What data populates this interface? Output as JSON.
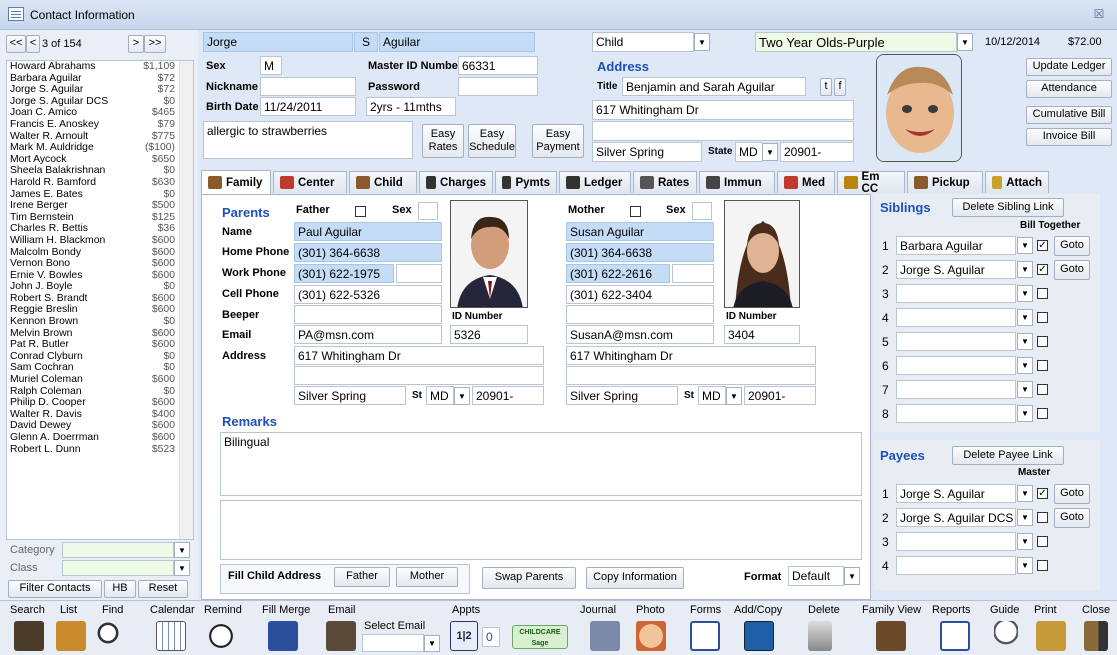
{
  "window": {
    "title": "Contact Information",
    "close": "☒"
  },
  "nav": {
    "first": "<<",
    "prev": "<",
    "record": "3 of 154",
    "next": ">",
    "last": ">>"
  },
  "contacts": [
    [
      "Howard Abrahams",
      "$1,109"
    ],
    [
      "Barbara Aguilar",
      "$72"
    ],
    [
      "Jorge S. Aguilar",
      "$72"
    ],
    [
      "Jorge S. Aguilar DCS",
      "$0"
    ],
    [
      "Joan C. Amico",
      "$465"
    ],
    [
      "Francis E. Anoskey",
      "$79"
    ],
    [
      "Walter R. Arnoult",
      "$775"
    ],
    [
      "Mark M. Auldridge",
      "($100)"
    ],
    [
      "Mort Aycock",
      "$650"
    ],
    [
      "Sheela Balakrishnan",
      "$0"
    ],
    [
      "Harold R. Bamford",
      "$630"
    ],
    [
      "James E. Bates",
      "$0"
    ],
    [
      "Irene Berger",
      "$500"
    ],
    [
      "Tim Bernstein",
      "$125"
    ],
    [
      "Charles R. Bettis",
      "$36"
    ],
    [
      "William H. Blackmon",
      "$600"
    ],
    [
      "Malcolm Bondy",
      "$600"
    ],
    [
      "Vernon Bono",
      "$600"
    ],
    [
      "Ernie V. Bowles",
      "$600"
    ],
    [
      "John J. Boyle",
      "$0"
    ],
    [
      "Robert S. Brandt",
      "$600"
    ],
    [
      "Reggie Breslin",
      "$600"
    ],
    [
      "Kennon Brown",
      "$0"
    ],
    [
      "Melvin Brown",
      "$600"
    ],
    [
      "Pat R. Butler",
      "$600"
    ],
    [
      "Conrad Clyburn",
      "$0"
    ],
    [
      "Sam Cochran",
      "$0"
    ],
    [
      "Muriel Coleman",
      "$600"
    ],
    [
      "Ralph Coleman",
      "$0"
    ],
    [
      "Philip D. Cooper",
      "$600"
    ],
    [
      "Walter R. Davis",
      "$400"
    ],
    [
      "David Dewey",
      "$600"
    ],
    [
      "Glenn A. Doerrman",
      "$600"
    ],
    [
      "Robert L. Dunn",
      "$523"
    ]
  ],
  "filters": {
    "category_label": "Category",
    "class_label": "Class",
    "filter_btn": "Filter Contacts",
    "hb_btn": "HB",
    "reset_btn": "Reset"
  },
  "header": {
    "first_name": "Jorge",
    "middle": "S",
    "last_name": "Aguilar",
    "type": "Child",
    "classroom": "Two Year Olds-Purple",
    "date": "10/12/2014",
    "amount": "$72.00",
    "sex_label": "Sex",
    "sex": "M",
    "master_id_label": "Master ID Number",
    "master_id": "66331",
    "nickname_label": "Nickname",
    "nickname": "",
    "password_label": "Password",
    "password": "",
    "birthdate_label": "Birth Date",
    "birthdate": "11/24/2011",
    "age": "2yrs - 11mths",
    "notes": "allergic to strawberries",
    "easy_rates": "Easy Rates",
    "easy_schedule": "Easy Schedule",
    "easy_payment": "Easy Payment"
  },
  "address": {
    "heading": "Address",
    "title_label": "Title",
    "title": "Benjamin and Sarah Aguilar",
    "t_btn": "t",
    "f_btn": "f",
    "street": "617 Whitingham Dr",
    "line2": "",
    "city": "Silver Spring",
    "state_label": "State",
    "state": "MD",
    "zip": "20901-"
  },
  "right_buttons": {
    "update_ledger": "Update Ledger",
    "attendance": "Attendance",
    "cumulative_bill": "Cumulative Bill",
    "invoice_bill": "Invoice Bill"
  },
  "tabs": [
    {
      "label": "Family",
      "color": "#8a5a2b"
    },
    {
      "label": "Center",
      "color": "#c0392b"
    },
    {
      "label": "Child",
      "color": "#8a5a2b"
    },
    {
      "label": "Charges",
      "color": "#333"
    },
    {
      "label": "Pymts",
      "color": "#333"
    },
    {
      "label": "Ledger",
      "color": "#333"
    },
    {
      "label": "Rates",
      "color": "#555"
    },
    {
      "label": "Immun",
      "color": "#444"
    },
    {
      "label": "Med",
      "color": "#c0392b"
    },
    {
      "label": "Em CC",
      "color": "#b8860b"
    },
    {
      "label": "Pickup",
      "color": "#8a5a2b"
    },
    {
      "label": "Attach",
      "color": "#c9a227"
    }
  ],
  "parents": {
    "heading": "Parents",
    "father_label": "Father",
    "mother_label": "Mother",
    "sex_label": "Sex",
    "name_label": "Name",
    "home_label": "Home Phone",
    "work_label": "Work Phone",
    "cell_label": "Cell Phone",
    "beeper_label": "Beeper",
    "email_label": "Email",
    "address_label": "Address",
    "id_label": "ID Number",
    "st_label": "St",
    "father": {
      "name": "Paul Aguilar",
      "home": "(301) 364-6638",
      "work": "(301) 622-1975",
      "cell": "(301) 622-5326",
      "beeper": "",
      "email": "PA@msn.com",
      "id": "5326",
      "street": "617 Whitingham Dr",
      "city": "Silver Spring",
      "state": "MD",
      "zip": "20901-"
    },
    "mother": {
      "name": "Susan Aguilar",
      "home": "(301) 364-6638",
      "work": "(301) 622-2616",
      "cell": "(301) 622-3404",
      "beeper": "",
      "email": "SusanA@msn.com",
      "id": "3404",
      "street": "617 Whitingham Dr",
      "city": "Silver Spring",
      "state": "MD",
      "zip": "20901-"
    }
  },
  "remarks": {
    "heading": "Remarks",
    "text": "Bilingual"
  },
  "bottom_bar": {
    "fill_label": "Fill Child Address",
    "father_btn": "Father",
    "mother_btn": "Mother",
    "swap_btn": "Swap Parents",
    "copy_btn": "Copy Information",
    "format_label": "Format",
    "format": "Default"
  },
  "siblings": {
    "heading": "Siblings",
    "delete_btn": "Delete Sibling Link",
    "bill_together": "Bill Together",
    "goto": "Goto",
    "rows": [
      {
        "n": "1",
        "name": "Barbara Aguilar",
        "checked": "✓"
      },
      {
        "n": "2",
        "name": "Jorge S. Aguilar",
        "checked": "✓"
      },
      {
        "n": "3",
        "name": "",
        "checked": ""
      },
      {
        "n": "4",
        "name": "",
        "checked": ""
      },
      {
        "n": "5",
        "name": "",
        "checked": ""
      },
      {
        "n": "6",
        "name": "",
        "checked": ""
      },
      {
        "n": "7",
        "name": "",
        "checked": ""
      },
      {
        "n": "8",
        "name": "",
        "checked": ""
      }
    ]
  },
  "payees": {
    "heading": "Payees",
    "delete_btn": "Delete Payee Link",
    "master": "Master",
    "goto": "Goto",
    "rows": [
      {
        "n": "1",
        "name": "Jorge S. Aguilar",
        "checked": "✓"
      },
      {
        "n": "2",
        "name": "Jorge S. Aguilar DCS",
        "checked": ""
      },
      {
        "n": "3",
        "name": "",
        "checked": ""
      },
      {
        "n": "4",
        "name": "",
        "checked": ""
      }
    ]
  },
  "toolbar": {
    "search": "Search",
    "list": "List",
    "find": "Find",
    "calendar": "Calendar",
    "remind": "Remind",
    "fill_merge": "Fill Merge",
    "email": "Email",
    "select_email": "Select Email",
    "appts": "Appts",
    "appts_count": "0",
    "sage_logo": "CHILDCARE Sage",
    "journal": "Journal",
    "photo": "Photo",
    "forms": "Forms",
    "add_copy": "Add/Copy",
    "delete": "Delete",
    "family_view": "Family View",
    "reports": "Reports",
    "guide": "Guide",
    "print": "Print",
    "close": "Close"
  }
}
